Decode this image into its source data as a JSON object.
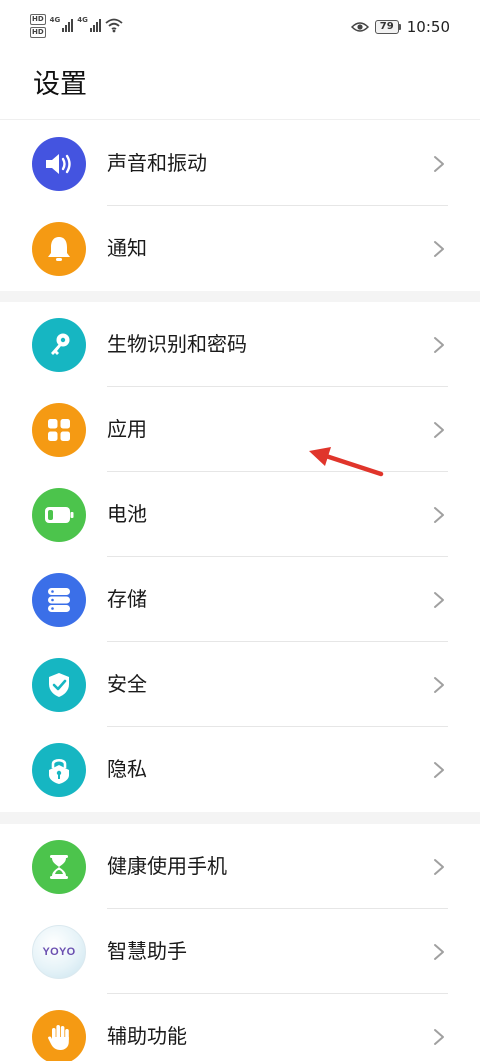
{
  "status_bar": {
    "left_badges": [
      "HD",
      "HD"
    ],
    "network_labels": [
      "4G",
      "4G"
    ],
    "battery_level": "79",
    "time": "10:50",
    "icons": [
      "wifi-icon",
      "eye-icon",
      "battery-icon"
    ]
  },
  "header": {
    "title": "设置"
  },
  "settings": {
    "items": [
      {
        "label": "声音和振动",
        "icon": "speaker-icon",
        "color": "#4454e0"
      },
      {
        "label": "通知",
        "icon": "bell-icon",
        "color": "#f59a13"
      },
      {
        "label": "生物识别和密码",
        "icon": "key-icon",
        "color": "#16b6c2"
      },
      {
        "label": "应用",
        "icon": "apps-grid-icon",
        "color": "#f59a13"
      },
      {
        "label": "电池",
        "icon": "battery-icon",
        "color": "#4cc44c"
      },
      {
        "label": "存储",
        "icon": "storage-icon",
        "color": "#3b6fe8"
      },
      {
        "label": "安全",
        "icon": "shield-check-icon",
        "color": "#16b6c2"
      },
      {
        "label": "隐私",
        "icon": "privacy-lock-icon",
        "color": "#16b6c2"
      },
      {
        "label": "健康使用手机",
        "icon": "hourglass-icon",
        "color": "#4cc44c"
      },
      {
        "label": "智慧助手",
        "icon": "yoyo-icon",
        "logo_text": "YOYO",
        "color": "#eef6fa"
      },
      {
        "label": "辅助功能",
        "icon": "hand-icon",
        "color": "#f59a13"
      }
    ]
  },
  "annotation": {
    "type": "red-arrow",
    "points_to": "应用",
    "color": "#e0352b"
  }
}
